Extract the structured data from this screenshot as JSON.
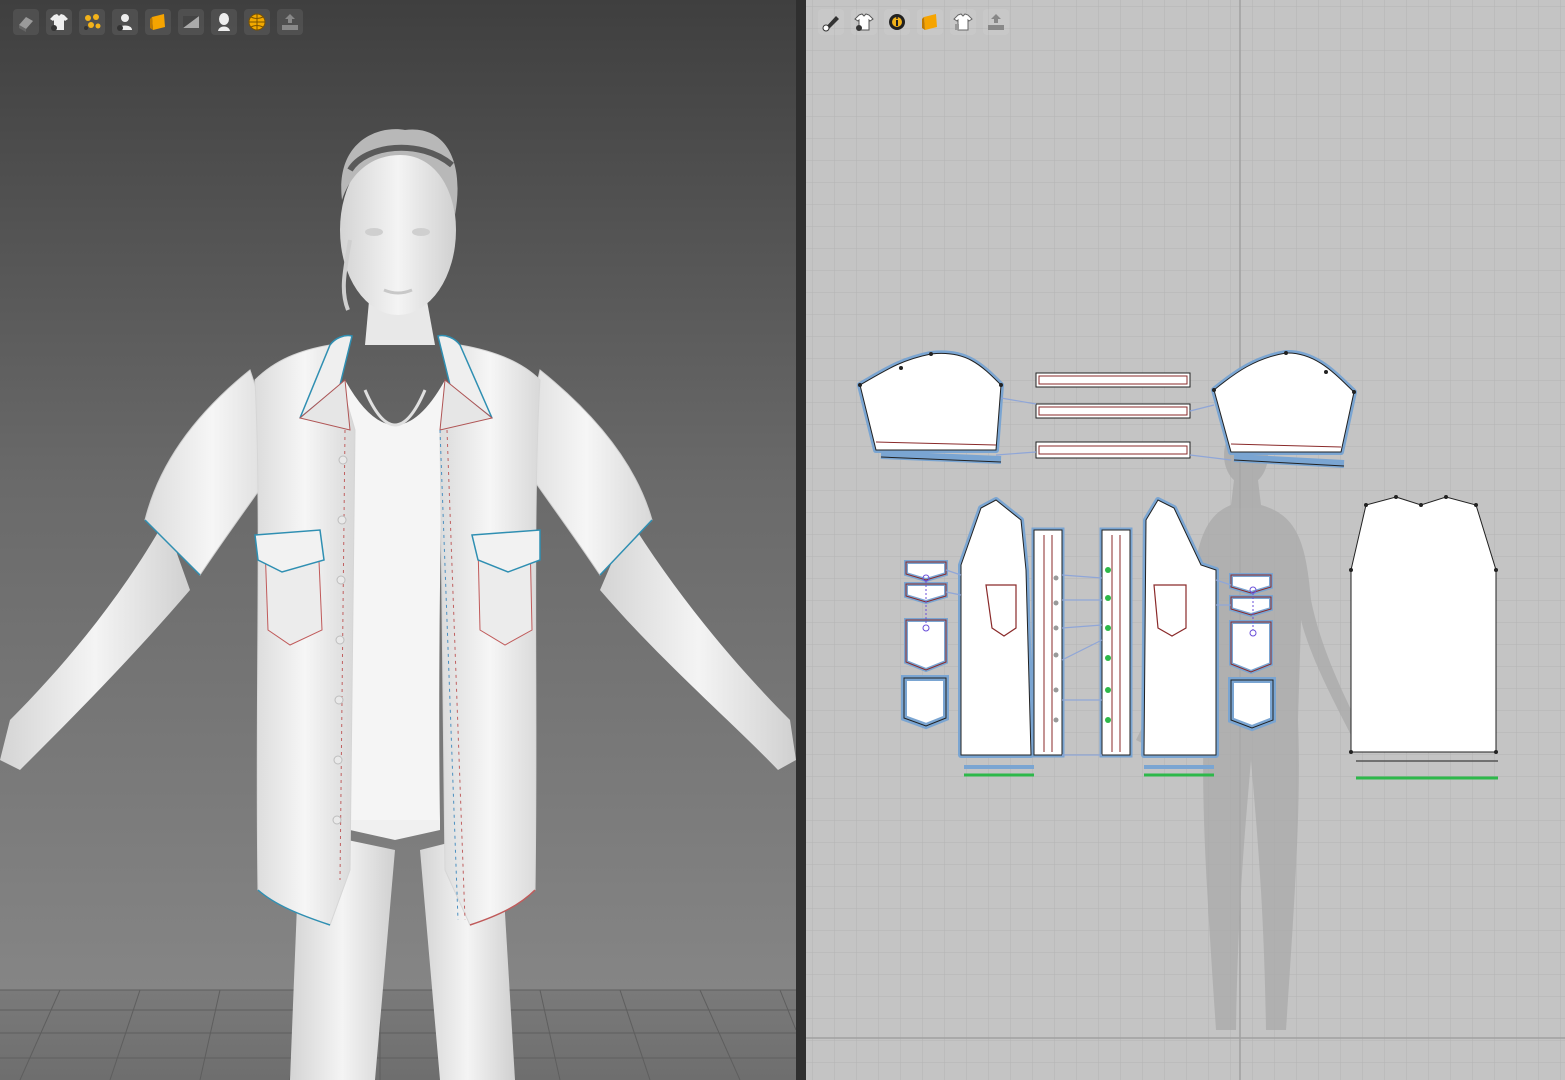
{
  "colors": {
    "viewport_3d_top": "#3f3f3f",
    "viewport_3d_bottom": "#8a8a8a",
    "viewport_2d_bg": "#c4c4c4",
    "grid_line": "#b2b2b2",
    "pattern_outline_selected": "#7aa5d2",
    "seam_line": "#8a2a2a",
    "topstitch_green": "#2db84a",
    "pin_purple": "#6a4fd8",
    "garment": "#f2f2f2"
  },
  "viewport_3d": {
    "toolbar_icons": [
      "3d-garment-display-icon",
      "garment-visibility-icon",
      "simulation-particles-icon",
      "avatar-display-icon",
      "fabric-texture-icon",
      "lighting-icon",
      "avatar-silhouette-icon",
      "mesh-globe-icon",
      "export-icon"
    ]
  },
  "viewport_2d": {
    "toolbar_icons": [
      "pen-edit-icon",
      "garment-display-icon",
      "info-icon",
      "fabric-texture-icon",
      "garment-arrangement-icon",
      "export-icon"
    ]
  }
}
